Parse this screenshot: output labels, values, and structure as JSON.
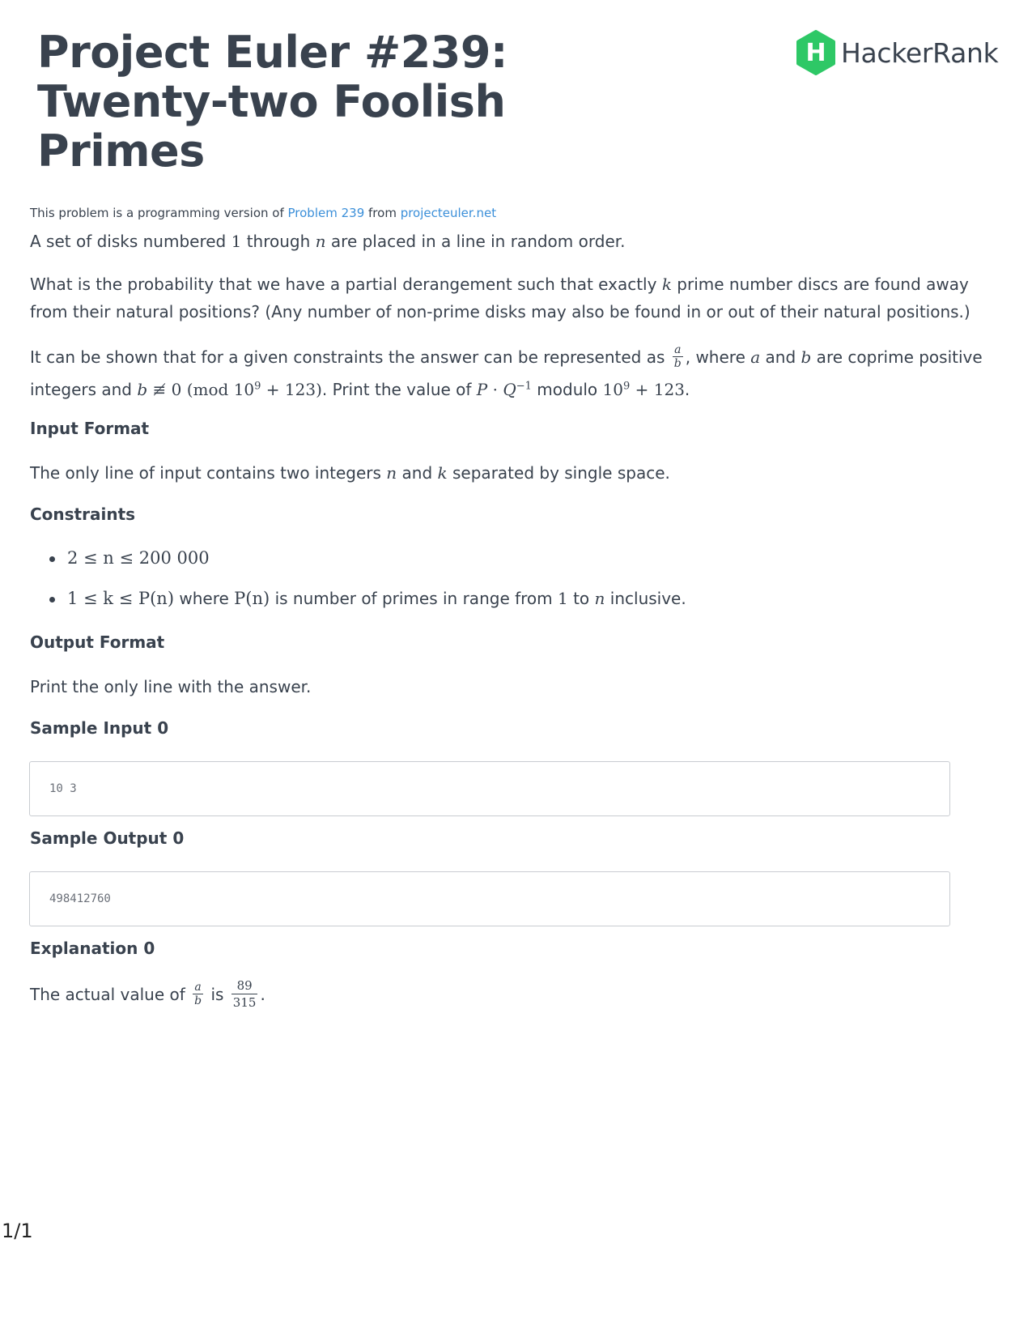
{
  "header": {
    "title_lines": [
      "Project Euler #239:",
      "Twenty-two Foolish",
      "Primes"
    ],
    "logo_text": "HackerRank",
    "logo_letter": "H",
    "logo_color": "#2ec866"
  },
  "source": {
    "prefix": "This problem is a programming version of ",
    "problem_link": "Problem 239",
    "middle": " from ",
    "site_link": "projecteuler.net"
  },
  "statement": {
    "p1": {
      "t1": "A set of disks numbered ",
      "m1": "1",
      "t2": " through ",
      "m2": "n",
      "t3": " are placed in a line in random order."
    },
    "p2": {
      "t1": "What is the probability that we have a partial derangement such that exactly ",
      "m1": "k",
      "t2": " prime number discs are found away from their natural positions? (Any number of non-prime disks may also be found in or out of their natural positions.)"
    },
    "p3": {
      "t1": "It can be shown that for a given constraints the answer can be represented as ",
      "frac_num": "a",
      "frac_den": "b",
      "t2": ", where ",
      "m_a": "a",
      "t3": " and ",
      "m_b": "b",
      "t4": " are coprime positive integers and ",
      "m_b2": "b",
      "m_neq": " ≢ 0  (mod  10",
      "exp9": "9",
      "m_plus": " + 123)",
      "t5": ". Print the value of ",
      "m_P": "P",
      "m_dot": " · ",
      "m_Q": "Q",
      "exp_neg1": "−1",
      "t6": " modulo ",
      "m_mod": "10",
      "exp9b": "9",
      "m_plus2": " + 123",
      "t7": "."
    }
  },
  "input_format": {
    "heading": "Input Format",
    "t1": "The only line of input contains two integers ",
    "m1": "n",
    "t2": " and ",
    "m2": "k",
    "t3": " separated by single space."
  },
  "constraints": {
    "heading": "Constraints",
    "c1": "2 ≤ n ≤ 200 000",
    "c2": {
      "m1": "1 ≤ k ≤ P(n)",
      "t1": " where ",
      "m2": "P(n)",
      "t2": " is number of primes in range from ",
      "m3": "1",
      "t3": " to ",
      "m4": "n",
      "t4": " inclusive."
    }
  },
  "output_format": {
    "heading": "Output Format",
    "text": "Print the only line with the answer."
  },
  "sample_input": {
    "heading": "Sample Input 0",
    "value": "10 3"
  },
  "sample_output": {
    "heading": "Sample Output 0",
    "value": "498412760"
  },
  "explanation": {
    "heading": "Explanation 0",
    "t1": "The actual value of ",
    "frac1_num": "a",
    "frac1_den": "b",
    "t2": " is ",
    "frac2_num": "89",
    "frac2_den": "315",
    "t3": "."
  },
  "footer": {
    "page_number": "1/1"
  }
}
